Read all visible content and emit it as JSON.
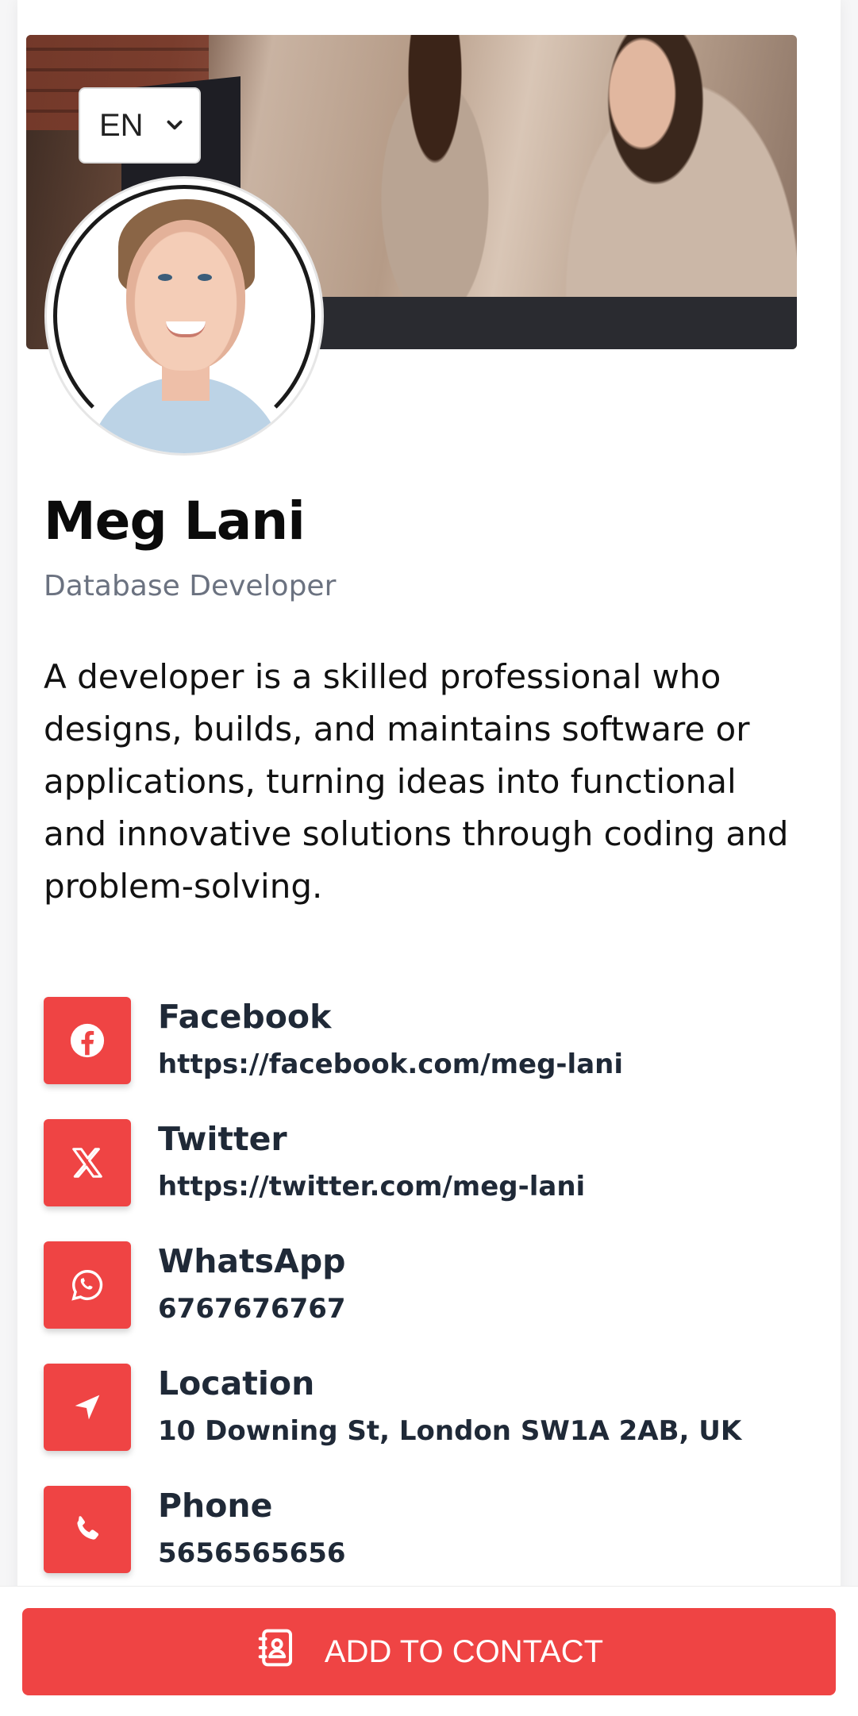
{
  "language_selector": {
    "value": "EN",
    "icon": "chevron-down-icon"
  },
  "profile": {
    "name": "Meg Lani",
    "title": "Database Developer",
    "bio": "A developer is a skilled professional who designs, builds, and maintains software or applications, turning ideas into functional and innovative solutions through coding and problem-solving."
  },
  "contacts": [
    {
      "label": "Facebook",
      "value": "https://facebook.com/meg-lani",
      "icon": "facebook-icon"
    },
    {
      "label": "Twitter",
      "value": "https://twitter.com/meg-lani",
      "icon": "x-twitter-icon"
    },
    {
      "label": "WhatsApp",
      "value": "6767676767",
      "icon": "whatsapp-icon"
    },
    {
      "label": "Location",
      "value": "10 Downing St, London SW1A 2AB, UK",
      "icon": "location-arrow-icon"
    },
    {
      "label": "Phone",
      "value": "5656565656",
      "icon": "phone-icon"
    }
  ],
  "actions": {
    "add_contact_label": "ADD TO CONTACT",
    "icon": "address-book-icon"
  },
  "colors": {
    "accent": "#ef4444",
    "text_dark": "#1f2937",
    "text_muted": "#6b7280"
  }
}
